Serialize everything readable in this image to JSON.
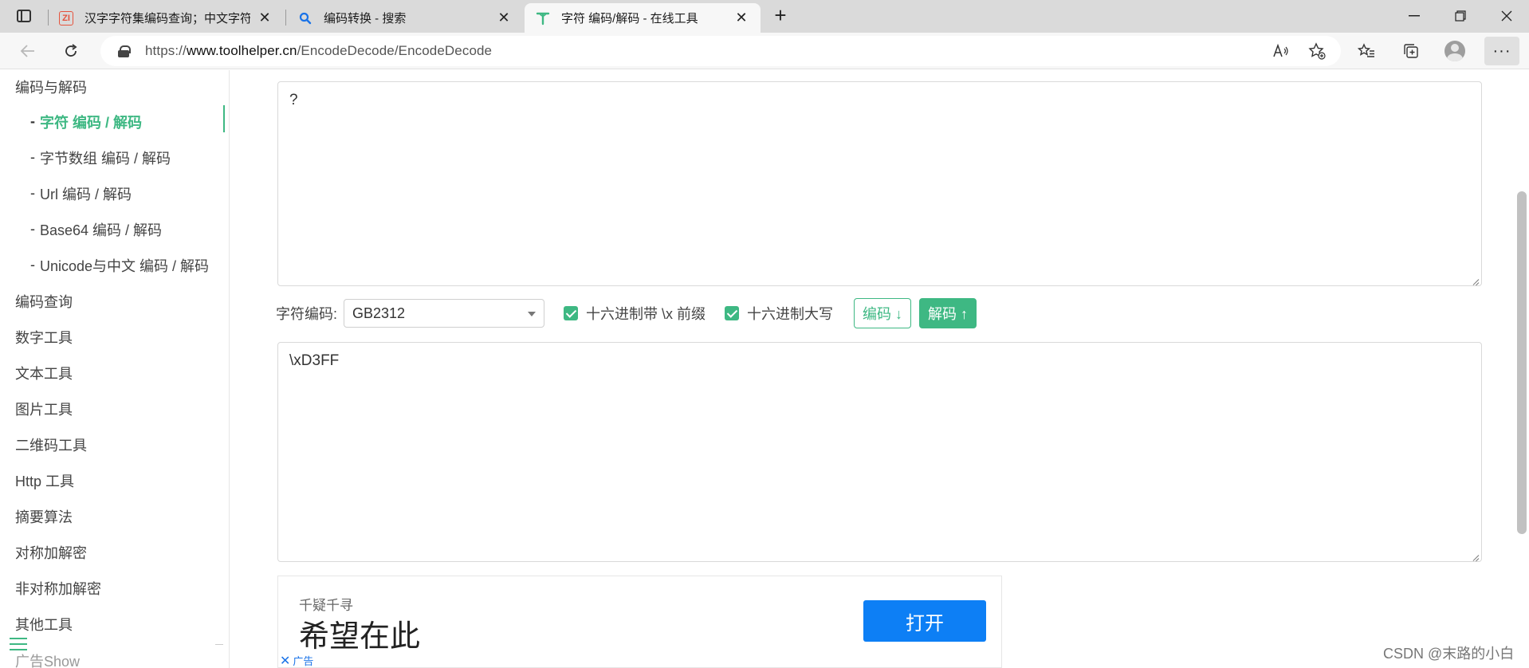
{
  "browser": {
    "tabs": [
      {
        "title": "汉字字符集编码查询；中文字符集",
        "favicon": "zi-logo",
        "active": false
      },
      {
        "title": "编码转换 - 搜索",
        "favicon": "search-icon",
        "active": false
      },
      {
        "title": "字符 编码/解码 - 在线工具",
        "favicon": "toolhelper-logo",
        "active": true
      }
    ],
    "new_tab": "+",
    "url_prefix": "https://",
    "url_host": "www.toolhelper.cn",
    "url_path": "/EncodeDecode/EncodeDecode"
  },
  "sidebar": {
    "groups": [
      {
        "label": "编码与解码",
        "type": "group"
      },
      {
        "label": "字符 编码 / 解码",
        "type": "sub",
        "active": true
      },
      {
        "label": "字节数组 编码 / 解码",
        "type": "sub"
      },
      {
        "label": "Url 编码 / 解码",
        "type": "sub"
      },
      {
        "label": "Base64 编码 / 解码",
        "type": "sub"
      },
      {
        "label": "Unicode与中文 编码 / 解码",
        "type": "sub"
      },
      {
        "label": "编码查询",
        "type": "group"
      },
      {
        "label": "数字工具",
        "type": "group"
      },
      {
        "label": "文本工具",
        "type": "group"
      },
      {
        "label": "图片工具",
        "type": "group"
      },
      {
        "label": "二维码工具",
        "type": "group"
      },
      {
        "label": "Http 工具",
        "type": "group"
      },
      {
        "label": "摘要算法",
        "type": "group"
      },
      {
        "label": "对称加解密",
        "type": "group"
      },
      {
        "label": "非对称加解密",
        "type": "group"
      },
      {
        "label": "其他工具",
        "type": "group"
      },
      {
        "label": "广告Show",
        "type": "group"
      }
    ],
    "dash": "-"
  },
  "main": {
    "input_text": "?",
    "charset_label": "字符编码:",
    "charset_value": "GB2312",
    "chk_prefix_label": "十六进制带 \\x 前缀",
    "chk_upper_label": "十六进制大写",
    "encode_button": "编码 ↓",
    "decode_button": "解码 ↑",
    "output_text": "\\xD3FF"
  },
  "ad": {
    "small_text": "千疑千寻",
    "big_text": "希望在此",
    "open_button": "打开",
    "tag_close": "✕",
    "tag_label": "广告"
  },
  "watermark": "CSDN @末路的小白",
  "colors": {
    "accent": "#3eb883",
    "ad_button": "#0d7ff5"
  }
}
